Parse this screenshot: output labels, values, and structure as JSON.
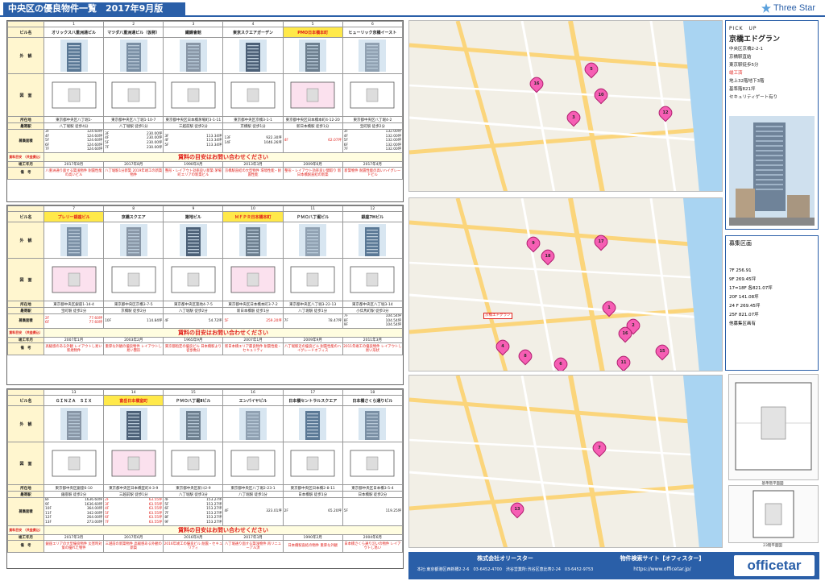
{
  "header": {
    "title": "中央区の優良物件一覧　2017年9月版",
    "logo": "Three Star"
  },
  "labels": {
    "name": "ビル名",
    "exterior": "外　観",
    "plan": "図　面",
    "address": "所在地",
    "station": "最寄駅",
    "area": "募集面積",
    "rent": "賃料目安\n（共益費込）",
    "built": "竣工年月",
    "remarks": "備　考"
  },
  "ask_text": "賃料の目安はお問い合わせください",
  "blocks": [
    {
      "buildings": [
        {
          "num": "1",
          "name": "オリックス八重洲通ビル",
          "address": "東京都中央区八丁堀1-",
          "station": "八丁堀駅 徒歩4分",
          "areas": [
            [
              "3F",
              "124.60坪"
            ],
            [
              "4F",
              "124.60坪"
            ],
            [
              "5F",
              "124.60坪"
            ],
            [
              "6F",
              "124.60坪"
            ],
            [
              "7F",
              "124.60坪"
            ]
          ],
          "built": "2017年8月",
          "remarks": "八重洲通り面する築浅物件\n耐震性能の高いビル"
        },
        {
          "num": "2",
          "name": "マツダ八重洲通ビル（仮称）",
          "address": "東京都中央区八丁堀1-10-7",
          "station": "八丁堀駅 徒歩1分",
          "areas": [
            [
              "3F",
              "230.00坪"
            ],
            [
              "4F",
              "230.00坪"
            ],
            [
              "5F",
              "230.00坪"
            ],
            [
              "7F",
              "230.00坪"
            ]
          ],
          "built": "2017年8月",
          "remarks": "八丁堀駅1分新築\n2019年竣工の新築物件"
        },
        {
          "num": "3",
          "name": "鐵鋼會館",
          "address": "東京都中央区日本橋茅場町3-1-11",
          "station": "三越前駅 徒歩2分",
          "areas": [
            [
              "3F",
              "113.34坪"
            ],
            [
              "4F",
              "113.34坪"
            ],
            [
              "5F",
              "113.34坪"
            ]
          ],
          "built": "1990年4月",
          "remarks": "整形・レイアウト効率良い新築\n茅場町エリアの新築ビル"
        },
        {
          "num": "4",
          "name": "東京スクエアガーデン",
          "address": "東京都中央区京橋3-1-1",
          "station": "京橋駅 徒歩1分",
          "areas": [
            [
              "13F",
              "922.30坪"
            ],
            [
              "14F",
              "1046.26坪"
            ]
          ],
          "built": "2013年3月",
          "remarks": "京橋駅直結の大型物件\n環境性能・耐震性能"
        },
        {
          "num": "5",
          "name": "PMO日本橋本町",
          "red": true,
          "address": "東京都中央区日本橋本町4-12-20",
          "station": "新日本橋駅 徒歩1分",
          "areas": [
            [
              "4F",
              "62.07坪"
            ]
          ],
          "built": "2009年6月",
          "remarks": "整形・レイアウト効率良い間取り\n新日本橋駅直結の新築"
        },
        {
          "num": "6",
          "name": "ヒューリック京橋イースト",
          "address": "東京都中央区八丁堀4-2",
          "station": "宝町駅 徒歩2分",
          "areas": [
            [
              "3F",
              "132.00坪"
            ],
            [
              "4F",
              "132.00坪"
            ],
            [
              "5F",
              "132.00坪"
            ],
            [
              "6F",
              "132.00坪"
            ],
            [
              "7F",
              "132.00坪"
            ]
          ],
          "built": "2017年4月",
          "remarks": "新築物件\n耐震性能の高いハイグレードビル"
        }
      ]
    },
    {
      "buildings": [
        {
          "num": "7",
          "name": "プレリー銀座ビル",
          "red": true,
          "address": "東京都中央区銀座1-14-4",
          "station": "宝町駅 徒歩2分",
          "areas": [
            [
              "2F",
              "77.60坪"
            ],
            [
              "6F",
              "77.60坪"
            ]
          ],
          "built": "2007年1月",
          "remarks": "高級感のある外観\nレイアウトし易い新規物件"
        },
        {
          "num": "8",
          "name": "京橋スクエア",
          "address": "東京都中央区京橋3-7-5",
          "station": "京橋駅 徒歩2分",
          "areas": [
            [
              "10F",
              "114.84坪"
            ]
          ],
          "built": "2003年2月",
          "remarks": "重厚な外観の優良物件\nレイアウトし易い整形"
        },
        {
          "num": "9",
          "name": "築地ビル",
          "address": "東京都中央区築地4-7-5",
          "station": "八丁堀駅 徒歩2分",
          "areas": [
            [
              "4F",
              "54.72坪"
            ]
          ],
          "built": "1965年9月",
          "remarks": "東京都指定の優良ビル\n日本橋駅より徒歩数分"
        },
        {
          "num": "10",
          "name": "ＭＦＰＲ日本橋本町",
          "red": true,
          "address": "東京都中央区日本橋本町3-7-2",
          "station": "新日本橋駅 徒歩1分",
          "areas": [
            [
              "5F",
              "259.20坪"
            ]
          ],
          "built": "2007年1月",
          "remarks": "新日本橋エリア最良物件\n耐震性能・セキュリティ"
        },
        {
          "num": "11",
          "name": "ＰＭＯ八丁堀ビル",
          "address": "東京都中央区八丁堀3-22-13",
          "station": "八丁堀駅 徒歩1分",
          "areas": [
            [
              "7F",
              "78.47坪"
            ]
          ],
          "built": "2009年9月",
          "remarks": "八丁堀駅近の優良ビル\n耐震性能のハイグレードオフィス"
        },
        {
          "num": "12",
          "name": "銀座7Hビル",
          "address": "東京都中央区八丁堀3-14",
          "station": "小伝馬町駅 徒歩3分",
          "areas": [
            [
              "7F",
              "104.54坪"
            ],
            [
              "8F",
              "104.54坪"
            ],
            [
              "9F",
              "104.54坪"
            ]
          ],
          "built": "2011年3月",
          "remarks": "2011年竣工の優良物件\nレイアウトし易い形状"
        }
      ]
    },
    {
      "buildings": [
        {
          "num": "13",
          "name": "ＧＩＮＺＡ　ＳＩＸ",
          "address": "東京都中央区銀座6-10",
          "station": "銀座駅 徒歩2分",
          "areas": [
            [
              "8F",
              "1636.60坪"
            ],
            [
              "9F",
              "1636.60坪"
            ],
            [
              "10F",
              "364.00坪"
            ],
            [
              "11F",
              "342.00坪"
            ],
            [
              "12F",
              "264.00坪"
            ],
            [
              "13F",
              "273.00坪"
            ]
          ],
          "built": "2017年3月",
          "remarks": "銀座エリアの大型優良物件\n災害時対策の優れた物件"
        },
        {
          "num": "14",
          "name": "富岳日本橋室町",
          "red": true,
          "address": "東京都中央区日本橋室町4-3-9",
          "station": "三越前駅 徒歩1分",
          "areas": [
            [
              "2F",
              "63.55坪"
            ],
            [
              "3F",
              "63.55坪"
            ],
            [
              "4F",
              "63.55坪"
            ],
            [
              "5F",
              "63.55坪"
            ],
            [
              "6F",
              "63.55坪"
            ],
            [
              "7F",
              "63.55坪"
            ]
          ],
          "built": "2017年6月",
          "remarks": "三越前の新築物件\n高級感ある外観の新築"
        },
        {
          "num": "15",
          "name": "ＰＭＯ八丁堀Ⅱビル",
          "address": "東京都中央区新川2-9",
          "station": "八丁堀駅 徒歩3分",
          "areas": [
            [
              "4F",
              "153.27坪"
            ],
            [
              "5F",
              "153.27坪"
            ],
            [
              "6F",
              "153.27坪"
            ],
            [
              "7F",
              "153.27坪"
            ],
            [
              "8F",
              "153.27坪"
            ],
            [
              "9F",
              "153.27坪"
            ]
          ],
          "built": "2016年4月",
          "remarks": "2016年竣工の優良ビル\n耐震・セキュリティ"
        },
        {
          "num": "16",
          "name": "エンパイヤビル",
          "address": "東京都中央区八丁堀2-23-1",
          "station": "八丁堀駅 徒歩1分",
          "areas": [
            [
              "4F",
              "323.01坪"
            ]
          ],
          "built": "2017年3月",
          "remarks": "八丁堀通り面する築浅物件\n再リニューアル済"
        },
        {
          "num": "17",
          "name": "日本橋セントラルスクエア",
          "address": "東京都中央区日本橋2-8-11",
          "station": "日本橋駅 徒歩1分",
          "areas": [
            [
              "2F",
              "65.20坪"
            ]
          ],
          "built": "1990年2月",
          "remarks": "日本橋駅直結の物件\n重厚な外観"
        },
        {
          "num": "18",
          "name": "日本橋さくら通りビル",
          "address": "東京都中央区日本橋3-5-4",
          "station": "日本橋駅 徒歩2分",
          "areas": [
            [
              "5F",
              "119.25坪"
            ]
          ],
          "built": "2004年6月",
          "remarks": "日本橋さくら通り沿いの物件\nレイアウトし易い"
        }
      ]
    }
  ],
  "maps": [
    {
      "markers": [
        "16",
        "5",
        "10",
        "3",
        "12"
      ]
    },
    {
      "markers": [
        "9",
        "18",
        "17",
        "1",
        "2",
        "16",
        "4",
        "8",
        "11",
        "15",
        "6"
      ],
      "highlight": "京橋エドグラン"
    },
    {
      "markers": [
        "7",
        "13"
      ]
    }
  ],
  "pickup": {
    "title": "PICK　UP",
    "name": "京橋エドグラン",
    "lines": [
      "中央区京橋2-2-1",
      "京橋駅直結",
      "東京駅徒歩5分",
      "",
      "地上32階地下3階",
      "基準階821坪",
      "セキュリティゲート有り"
    ],
    "red_line": "竣工済"
  },
  "boshu": {
    "title": "募集区画",
    "lines": [
      "7F 256.91",
      "9F 269.45坪",
      "17=18F 各821.07坪",
      "20F 141.08坪",
      "24 F 269.45坪",
      "25F 821.07坪",
      "他募集区画有"
    ]
  },
  "captions": {
    "fp1": "基準階平面図",
    "fp2": "23階平面図"
  },
  "footer": {
    "company": "株式会社オリースター",
    "address": "本社:東京都港区西新橋2-2-6　03-6452-4700　渋谷営業所:渋谷区恵比寿2-24　03-6452-9753",
    "site": "物件検索サイト【オフィスター】",
    "url": "https://www.officetar.jp/",
    "brand": "officetar"
  }
}
